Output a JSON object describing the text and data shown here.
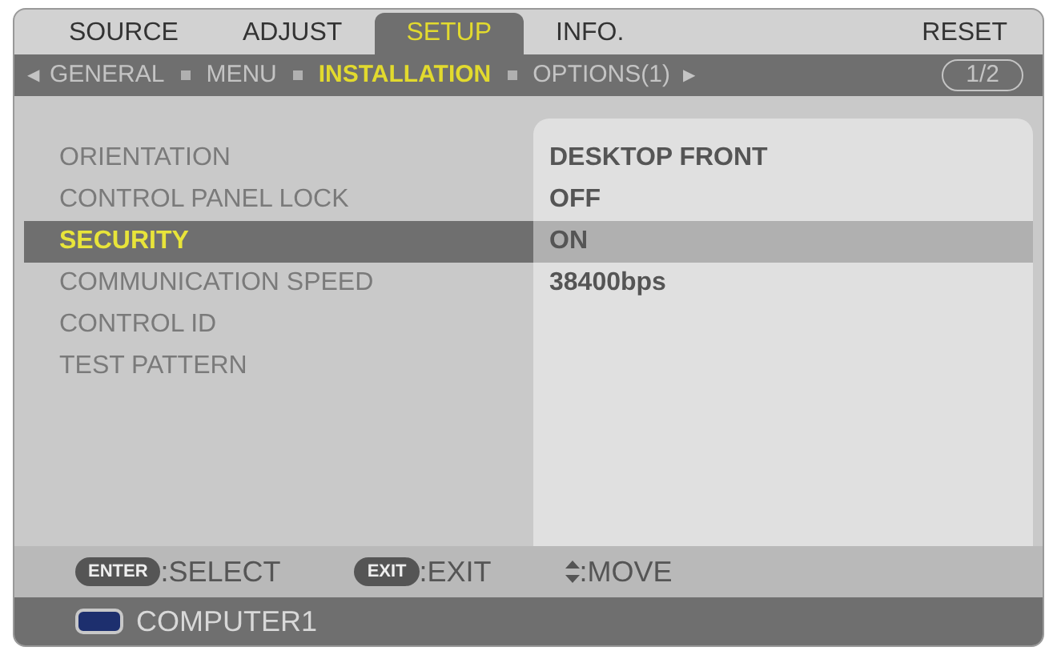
{
  "tabs": [
    {
      "label": "SOURCE",
      "selected": false
    },
    {
      "label": "ADJUST",
      "selected": false
    },
    {
      "label": "SETUP",
      "selected": true
    },
    {
      "label": "INFO.",
      "selected": false
    },
    {
      "label": "RESET",
      "selected": false
    }
  ],
  "subtabs": {
    "prev": "◀",
    "next": "▶",
    "page": "1/2",
    "items": [
      {
        "label": "GENERAL",
        "selected": false
      },
      {
        "label": "MENU",
        "selected": false
      },
      {
        "label": "INSTALLATION",
        "selected": true
      },
      {
        "label": "OPTIONS(1)",
        "selected": false
      }
    ]
  },
  "rows": [
    {
      "label": "ORIENTATION",
      "value": "DESKTOP FRONT",
      "selected": false
    },
    {
      "label": "CONTROL PANEL LOCK",
      "value": "OFF",
      "selected": false
    },
    {
      "label": "SECURITY",
      "value": "ON",
      "selected": true
    },
    {
      "label": "COMMUNICATION SPEED",
      "value": "38400bps",
      "selected": false
    },
    {
      "label": "CONTROL ID",
      "selected": false
    },
    {
      "label": "TEST PATTERN",
      "selected": false
    }
  ],
  "hints": [
    {
      "kind": "key",
      "key": "ENTER",
      "text": ":SELECT"
    },
    {
      "kind": "key",
      "key": "EXIT",
      "text": ":EXIT"
    },
    {
      "kind": "arrows",
      "text": ":MOVE"
    }
  ],
  "status": {
    "source": "COMPUTER1"
  }
}
